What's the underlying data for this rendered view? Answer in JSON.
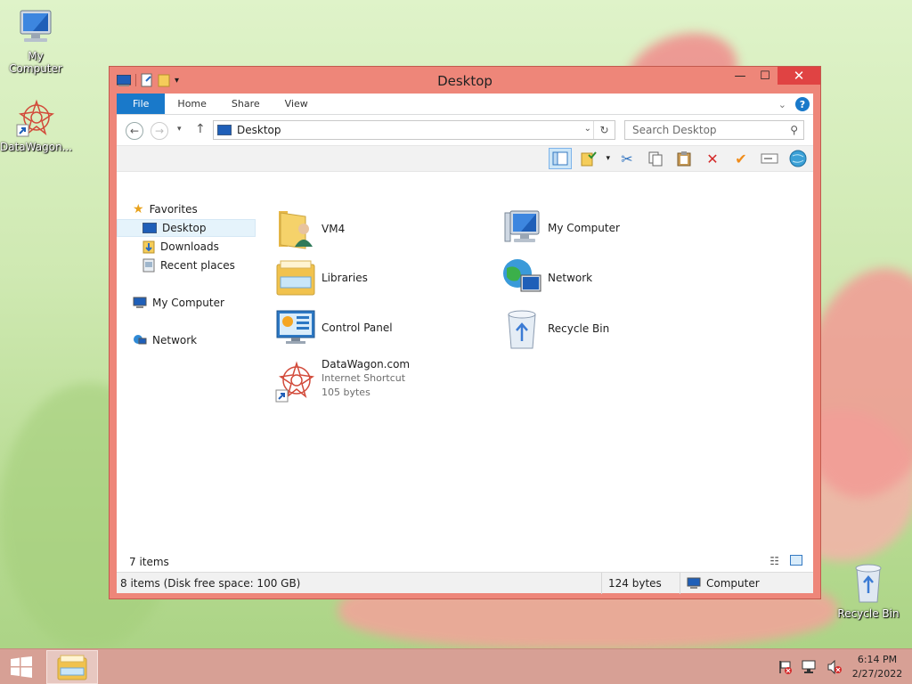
{
  "desktop": {
    "icons": [
      {
        "label": "My Computer",
        "icon": "computer-icon"
      },
      {
        "label": "DataWagon...",
        "icon": "datawagon-shortcut-icon"
      },
      {
        "label": "Recycle Bin",
        "icon": "recycle-bin-icon"
      }
    ]
  },
  "window": {
    "title": "Desktop",
    "controls": {
      "minimize": "—",
      "maximize": "☐",
      "close": "✕"
    },
    "ribbon_tabs": [
      "File",
      "Home",
      "Share",
      "View"
    ],
    "address": "Desktop",
    "search_placeholder": "Search Desktop",
    "nav": {
      "favorites": "Favorites",
      "desktop": "Desktop",
      "downloads": "Downloads",
      "recent": "Recent places",
      "my_computer": "My Computer",
      "network": "Network"
    },
    "items": [
      {
        "name": "VM4",
        "icon": "user-folder-icon"
      },
      {
        "name": "My Computer",
        "icon": "computer-icon"
      },
      {
        "name": "Libraries",
        "icon": "libraries-icon"
      },
      {
        "name": "Network",
        "icon": "network-icon"
      },
      {
        "name": "Control Panel",
        "icon": "control-panel-icon"
      },
      {
        "name": "Recycle Bin",
        "icon": "recycle-bin-icon"
      },
      {
        "name": "DataWagon.com",
        "type": "Internet Shortcut",
        "size": "105 bytes",
        "icon": "datawagon-shortcut-icon"
      }
    ],
    "item_count": "7 items",
    "status": {
      "summary": "8 items (Disk free space: 100 GB)",
      "size": "124 bytes",
      "location": "Computer"
    }
  },
  "taskbar": {
    "time": "6:14 PM",
    "date": "2/27/2022"
  },
  "colors": {
    "accent": "#ee8679",
    "file_tab": "#1979ca",
    "taskbar": "#d7a095",
    "close_button": "#e04343"
  }
}
